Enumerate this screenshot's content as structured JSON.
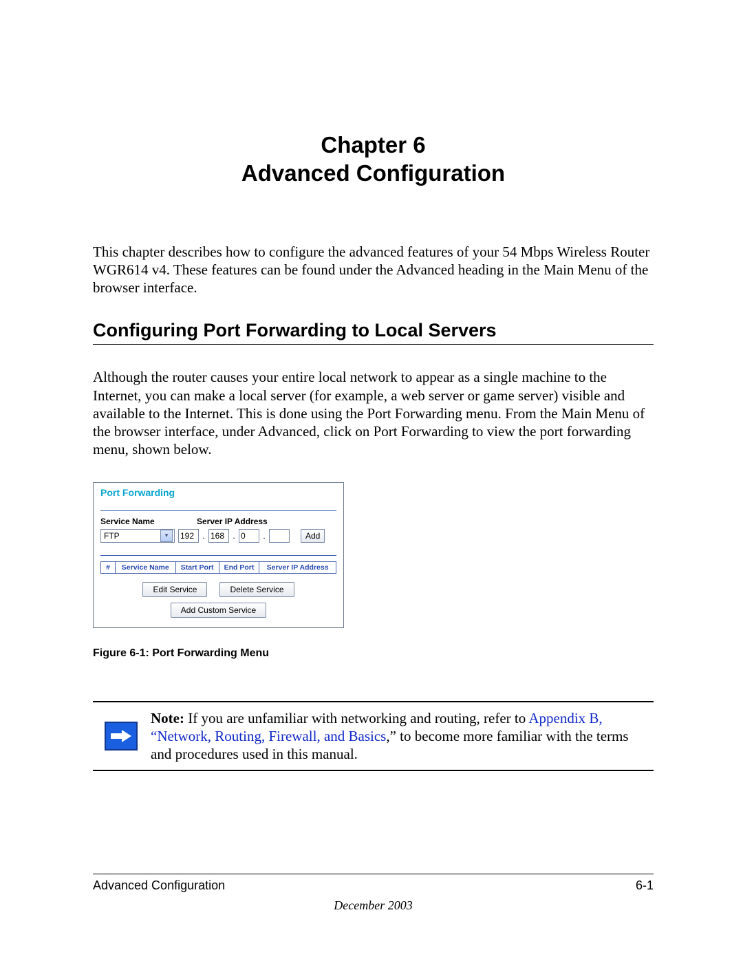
{
  "chapter": {
    "line1": "Chapter 6",
    "line2": "Advanced Configuration"
  },
  "intro": "This chapter describes how to configure the advanced features of your 54 Mbps Wireless Router WGR614 v4. These features can be found under the Advanced heading in the Main Menu of the browser interface.",
  "section_heading": "Configuring Port Forwarding to Local Servers",
  "section_body": "Although the router causes your entire local network to appear as a single machine to the Internet, you can make a local server (for example, a web server or game server) visible and available to the Internet. This is done using the Port Forwarding menu. From the Main Menu of the browser interface, under Advanced, click on Port Forwarding to view the port forwarding menu, shown below.",
  "figure": {
    "title": "Port Forwarding",
    "service_label": "Service Name",
    "ip_label": "Server IP Address",
    "service_value": "FTP",
    "ip": {
      "a": "192",
      "b": "168",
      "c": "0",
      "d": ""
    },
    "add_btn": "Add",
    "table": {
      "num": "#",
      "col1": "Service Name",
      "col2": "Start Port",
      "col3": "End Port",
      "col4": "Server IP Address"
    },
    "edit_btn": "Edit Service",
    "delete_btn": "Delete Service",
    "custom_btn": "Add Custom Service",
    "caption": "Figure 6-1:  Port Forwarding Menu"
  },
  "note": {
    "prefix": "Note:",
    "before_link": " If you are unfamiliar with networking and routing, refer to ",
    "link": "Appendix B, “Network, Routing, Firewall, and Basics",
    "after_link": ",” to become more familiar with the terms and procedures used in this manual."
  },
  "footer": {
    "left": "Advanced Configuration",
    "right": "6-1",
    "date": "December 2003"
  }
}
